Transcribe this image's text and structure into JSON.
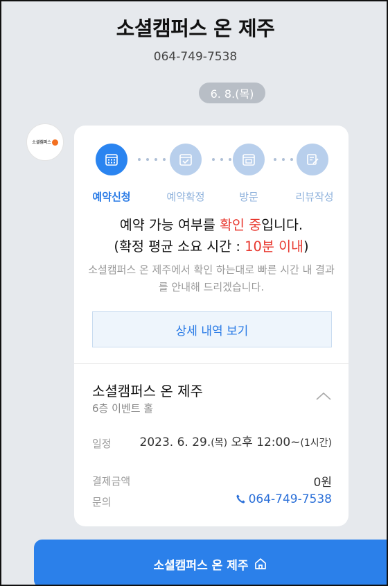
{
  "header": {
    "title": "소셜캠퍼스 온 제주",
    "phone": "064-749-7538"
  },
  "date_pill": "6. 8.(목)",
  "avatar": {
    "logo_text": "소셜캠퍼스 온 제주"
  },
  "steps": [
    {
      "label": "예약신청",
      "icon": "calendar-icon",
      "active": true
    },
    {
      "label": "예약확정",
      "icon": "calendar-check-icon",
      "active": false
    },
    {
      "label": "방문",
      "icon": "calendar-visit-icon",
      "active": false
    },
    {
      "label": "리뷰작성",
      "icon": "edit-review-icon",
      "active": false
    }
  ],
  "message": {
    "line1_prefix": "예약 가능 여부를 ",
    "line1_highlight": "확인 중",
    "line1_suffix": "입니다.",
    "line2_prefix": "(확정 평균 소요 시간 : ",
    "line2_highlight": "10분 이내",
    "line2_suffix": ")"
  },
  "sub_message": "소셜캠퍼스 온 제주에서 확인 하는대로 빠른 시간 내 결과를 안내해 드리겠습니다.",
  "detail_button": "상세 내역 보기",
  "place": {
    "name": "소셜캠퍼스 온 제주",
    "sub": "6층 이벤트 홀"
  },
  "info": {
    "schedule_label": "일정",
    "schedule_date": "2023. 6. 29.",
    "schedule_day": "(목)",
    "schedule_time": " 오후 12:00~",
    "schedule_duration": "(1시간)",
    "payment_label": "결제금액",
    "payment_value": "0원",
    "inquiry_label": "문의",
    "inquiry_phone": "064-749-7538"
  },
  "bottom_button": "소셜캠퍼스 온 제주",
  "colors": {
    "accent": "#2a84f0",
    "highlight_red": "#e8382f",
    "background": "#e6e9ed"
  }
}
